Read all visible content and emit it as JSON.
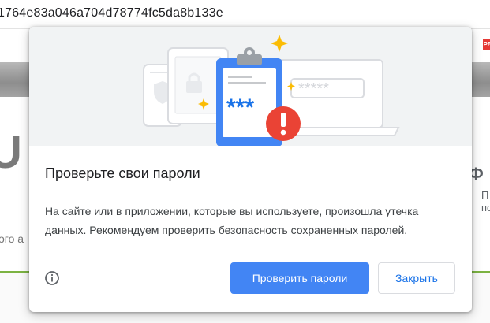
{
  "browser": {
    "url": "1764e83a046a704d78774fc5da8b133e",
    "site_badge": "РБ"
  },
  "background_page": {
    "big_letter": "U",
    "snippet": "ого а",
    "right_heading": "Ф",
    "right_line_1": "П",
    "right_line_2": "по"
  },
  "dialog": {
    "illustration": {
      "icons": [
        "shield-icon",
        "lock-icon",
        "clipboard-icon",
        "alert-icon",
        "sparkle-icon"
      ],
      "clipboard_text": "***",
      "password_field_text": "*****",
      "colors": {
        "clipboard": "#4285f4",
        "alert": "#ea4335",
        "sparkle": "#fbbc04",
        "device_outline": "#dadce0"
      }
    },
    "title": "Проверьте свои пароли",
    "body": "На сайте или в приложении, которые вы используете, произошла утечка данных. Рекомендуем проверить безопасность сохраненных паролей.",
    "info_icon": "info-icon",
    "primary_button": "Проверить пароли",
    "secondary_button": "Закрыть",
    "colors": {
      "primary": "#4285f4",
      "link": "#1a73e8"
    }
  }
}
